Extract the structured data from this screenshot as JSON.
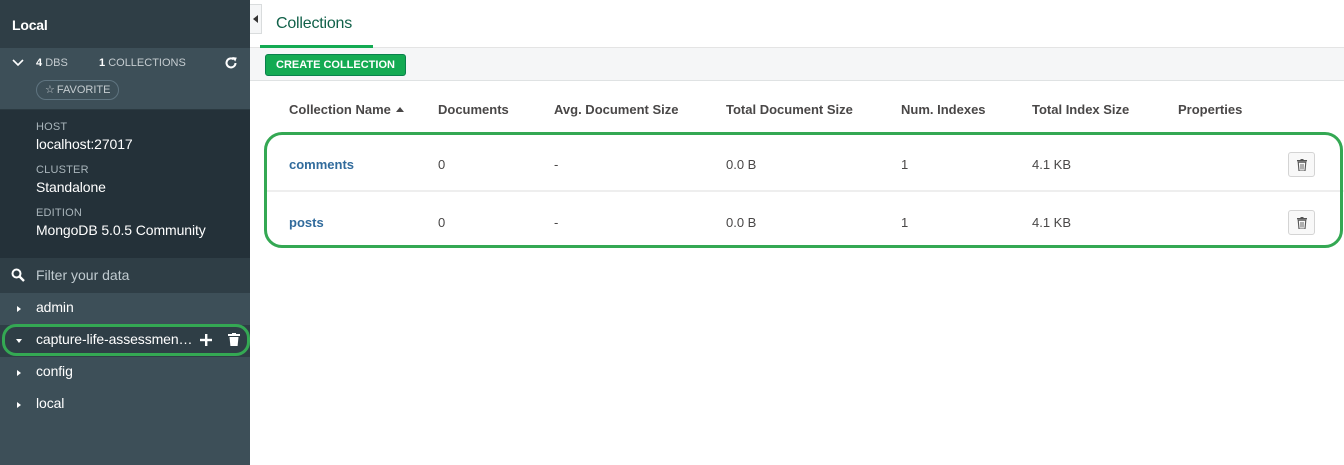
{
  "sidebar": {
    "title": "Local",
    "stats": {
      "dbs_count": "4",
      "dbs_label": "DBS",
      "collections_count": "1",
      "collections_label": "COLLECTIONS"
    },
    "favorite_label": "FAVORITE",
    "info": [
      {
        "label": "HOST",
        "value": "localhost:27017"
      },
      {
        "label": "CLUSTER",
        "value": "Standalone"
      },
      {
        "label": "EDITION",
        "value": "MongoDB 5.0.5 Community"
      }
    ],
    "filter_placeholder": "Filter your data",
    "databases": [
      {
        "name": "admin"
      },
      {
        "name": "capture-life-assessment-db"
      },
      {
        "name": "config"
      },
      {
        "name": "local"
      }
    ]
  },
  "main": {
    "tab_label": "Collections",
    "create_button_label": "CREATE COLLECTION",
    "table": {
      "headers": [
        "Collection Name",
        "Documents",
        "Avg. Document Size",
        "Total Document Size",
        "Num. Indexes",
        "Total Index Size",
        "Properties"
      ],
      "rows": [
        {
          "name": "comments",
          "documents": "0",
          "avg_size": "-",
          "total_size": "0.0 B",
          "indexes": "1",
          "index_size": "4.1 KB",
          "properties": ""
        },
        {
          "name": "posts",
          "documents": "0",
          "avg_size": "-",
          "total_size": "0.0 B",
          "indexes": "1",
          "index_size": "4.1 KB",
          "properties": ""
        }
      ]
    }
  },
  "colors": {
    "accent": "#13aa52",
    "highlight": "#34a853",
    "sidebar_bg": "#3d4f58",
    "link": "#316b9c"
  }
}
